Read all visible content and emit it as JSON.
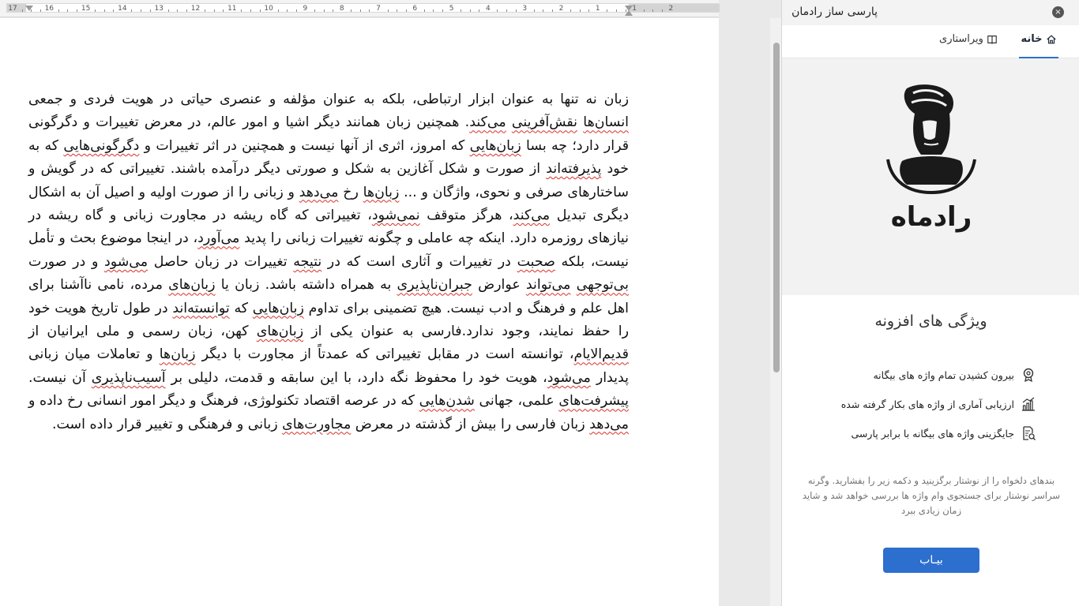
{
  "ruler": {
    "numbers": [
      "17",
      "16",
      "15",
      "14",
      "13",
      "12",
      "11",
      "10",
      "9",
      "8",
      "7",
      "6",
      "5",
      "4",
      "3",
      "2",
      "1",
      "1",
      "2"
    ]
  },
  "document": {
    "paragraph": [
      {
        "t": "زبان نه تنها به عنوان ابزار ارتباطی، بلکه به عنوان مؤلفه و عنصری حیاتی در هویت فردی و جمعی "
      },
      {
        "t": "انسان‌ها",
        "s": true
      },
      {
        "t": " "
      },
      {
        "t": "نقش‌آفرینی",
        "s": true
      },
      {
        "t": " "
      },
      {
        "t": "می‌کند",
        "s": true
      },
      {
        "t": ". همچنین زبان همانند دیگر اشیا و امور عالم، در معرض تغییرات و دگرگونی قرار دارد؛ چه بسا "
      },
      {
        "t": "زبان‌هایی",
        "s": true
      },
      {
        "t": " که امروز، اثری از آنها نیست و همچنین در اثر تغییرات و "
      },
      {
        "t": "دگرگونی‌هایی",
        "s": true
      },
      {
        "t": " که به خود "
      },
      {
        "t": "پذیرفته‌اند",
        "s": true
      },
      {
        "t": " از صورت و شکل آغازین به شکل و صورتی دیگر درآمده باشند. تغییراتی که در گویش و ساختارهای صرفی و نحوی، واژگان و ... "
      },
      {
        "t": "زبان‌ها",
        "s": true
      },
      {
        "t": " رخ "
      },
      {
        "t": "می‌دهد",
        "s": true
      },
      {
        "t": " و زبانی را از صورت اولیه و اصیل آن به اشکال دیگری تبدیل "
      },
      {
        "t": "می‌کند",
        "s": true
      },
      {
        "t": "، هرگز متوقف "
      },
      {
        "t": "نمی‌شود",
        "s": true
      },
      {
        "t": "، تغییراتی که گاه ریشه در مجاورت زبانی و گاه ریشه در نیازهای روزمره دارد. اینکه چه عاملی و چگونه تغییرات زبانی را پدید "
      },
      {
        "t": "می‌آورد",
        "s": true
      },
      {
        "t": "، در اینجا موضوع بحث و تأمل نیست، بلکه "
      },
      {
        "t": "صحبت",
        "s": true
      },
      {
        "t": " در تغییرات و آثاری است که در "
      },
      {
        "t": "نتیجه",
        "s": true
      },
      {
        "t": " تغییرات در زبان حاصل "
      },
      {
        "t": "می‌شود",
        "s": true
      },
      {
        "t": " و در صورت "
      },
      {
        "t": "بی‌توجهی",
        "s": true
      },
      {
        "t": " "
      },
      {
        "t": "می‌تواند",
        "s": true
      },
      {
        "t": " عوارض "
      },
      {
        "t": "جبران‌ناپذیری",
        "s": true
      },
      {
        "t": " به همراه داشته باشد. زبان یا "
      },
      {
        "t": "زبان‌های",
        "s": true
      },
      {
        "t": " مرده، نامی ناآشنا برای اهل علم و فرهنگ و ادب نیست. هیچ تضمینی برای تداوم "
      },
      {
        "t": "زبان‌هایی",
        "s": true
      },
      {
        "t": " که "
      },
      {
        "t": "توانسته‌اند",
        "s": true
      },
      {
        "t": " در طول تاریخ هویت خود را حفظ نمایند، وجود ندارد.فارسی به عنوان یکی از "
      },
      {
        "t": "زبان‌های",
        "s": true
      },
      {
        "t": " کهن، زبان رسمی و ملی ایرانیان از "
      },
      {
        "t": "قدیم‌الایام",
        "s": true
      },
      {
        "t": "، توانسته است در مقابل تغییراتی که عمدتاً از مجاورت با دیگر "
      },
      {
        "t": "زبان‌ها",
        "s": true
      },
      {
        "t": " و تعاملات میان زبانی پدیدار "
      },
      {
        "t": "می‌شود",
        "s": true
      },
      {
        "t": "، هویت خود را محفوظ نگه دارد، با این سابقه و قدمت، دلیلی بر "
      },
      {
        "t": "آسیب‌ناپذیری",
        "s": true
      },
      {
        "t": " آن نیست. "
      },
      {
        "t": "پیشرفت‌های",
        "s": true
      },
      {
        "t": " علمی، جهانی "
      },
      {
        "t": "شدن‌هایی",
        "s": true
      },
      {
        "t": " که در عرصه اقتصاد تکنولوژی، فرهنگ و دیگر امور انسانی رخ داده و "
      },
      {
        "t": "می‌دهد",
        "s": true
      },
      {
        "t": " زبان فارسی را بیش از گذشته در معرض "
      },
      {
        "t": "مجاورت‌های",
        "s": true
      },
      {
        "t": " زبانی و فرهنگی و تغییر قرار داده است."
      }
    ]
  },
  "panel": {
    "title": "پارسی ساز رادمان",
    "close_label": "×",
    "tabs": [
      {
        "label": "خانه",
        "icon": "home-icon",
        "active": true
      },
      {
        "label": "ویراستاری",
        "icon": "book-icon",
        "active": false
      }
    ],
    "logo": {
      "wordmark": "رادماه"
    },
    "features_title": "ویژگی های افزونه",
    "features": [
      {
        "label": "بیرون کشیدن تمام واژه های بیگانه",
        "icon": "badge-icon"
      },
      {
        "label": "ارزیابی آماری از واژه های بکار گرفته شده",
        "icon": "chart-icon"
      },
      {
        "label": "جایگزینی واژه های بیگانه با برابر پارسی",
        "icon": "document-search-icon"
      }
    ],
    "note": "بندهای دلخواه را از نوشتار برگزینید و دکمه زیر را بفشارید. وگرنه سراسر نوشتار برای جستجوی وام واژه ها بررسی خواهد شد و شاید زمان زیادی ببرد",
    "find_button": "بیـاب"
  },
  "colors": {
    "accent": "#2d6fcf",
    "spell_error": "#d93025",
    "panel_header": "#f3f3f3",
    "logo_background": "#f2f2f2"
  }
}
